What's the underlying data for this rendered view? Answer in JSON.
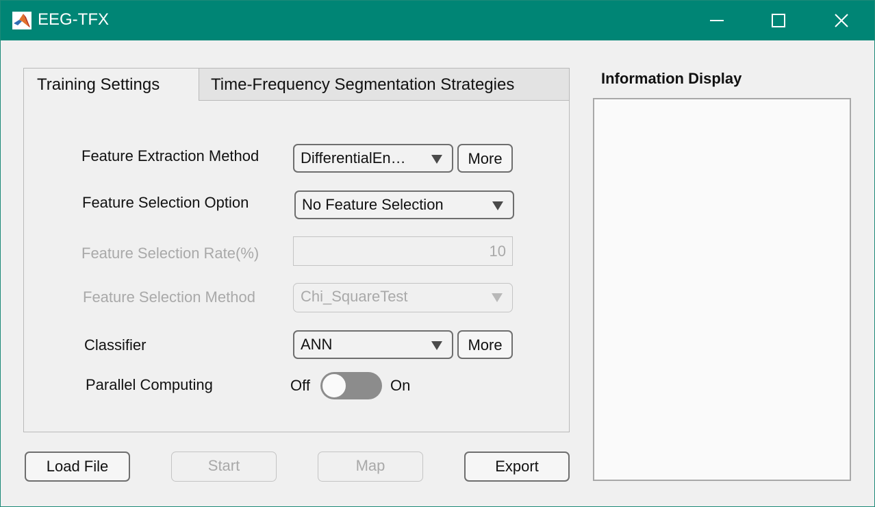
{
  "window": {
    "title": "EEG-TFX",
    "controls": {
      "minimize": "minimize-icon",
      "maximize": "maximize-icon",
      "close": "close-icon"
    }
  },
  "tabs": [
    {
      "label": "Training Settings",
      "active": true
    },
    {
      "label": "Time-Frequency Segmentation Strategies",
      "active": false
    }
  ],
  "training": {
    "feature_extraction": {
      "label": "Feature Extraction Method",
      "value": "DifferentialEn…",
      "more_label": "More"
    },
    "feature_selection_option": {
      "label": "Feature Selection Option",
      "value": "No Feature Selection"
    },
    "feature_selection_rate": {
      "label": "Feature Selection Rate(%)",
      "value": "10",
      "enabled": false
    },
    "feature_selection_method": {
      "label": "Feature Selection Method",
      "value": "Chi_SquareTest",
      "enabled": false
    },
    "classifier": {
      "label": "Classifier",
      "value": "ANN",
      "more_label": "More"
    },
    "parallel_computing": {
      "label": "Parallel Computing",
      "off_label": "Off",
      "on_label": "On",
      "state": "off"
    }
  },
  "actions": {
    "load_file": {
      "label": "Load File",
      "enabled": true
    },
    "start": {
      "label": "Start",
      "enabled": false
    },
    "map": {
      "label": "Map",
      "enabled": false
    },
    "export": {
      "label": "Export",
      "enabled": true
    }
  },
  "info_display": {
    "title": "Information Display",
    "content": ""
  },
  "colors": {
    "titlebar": "#008575",
    "background": "#f0f0f0",
    "disabled_text": "#a9a9a9"
  }
}
